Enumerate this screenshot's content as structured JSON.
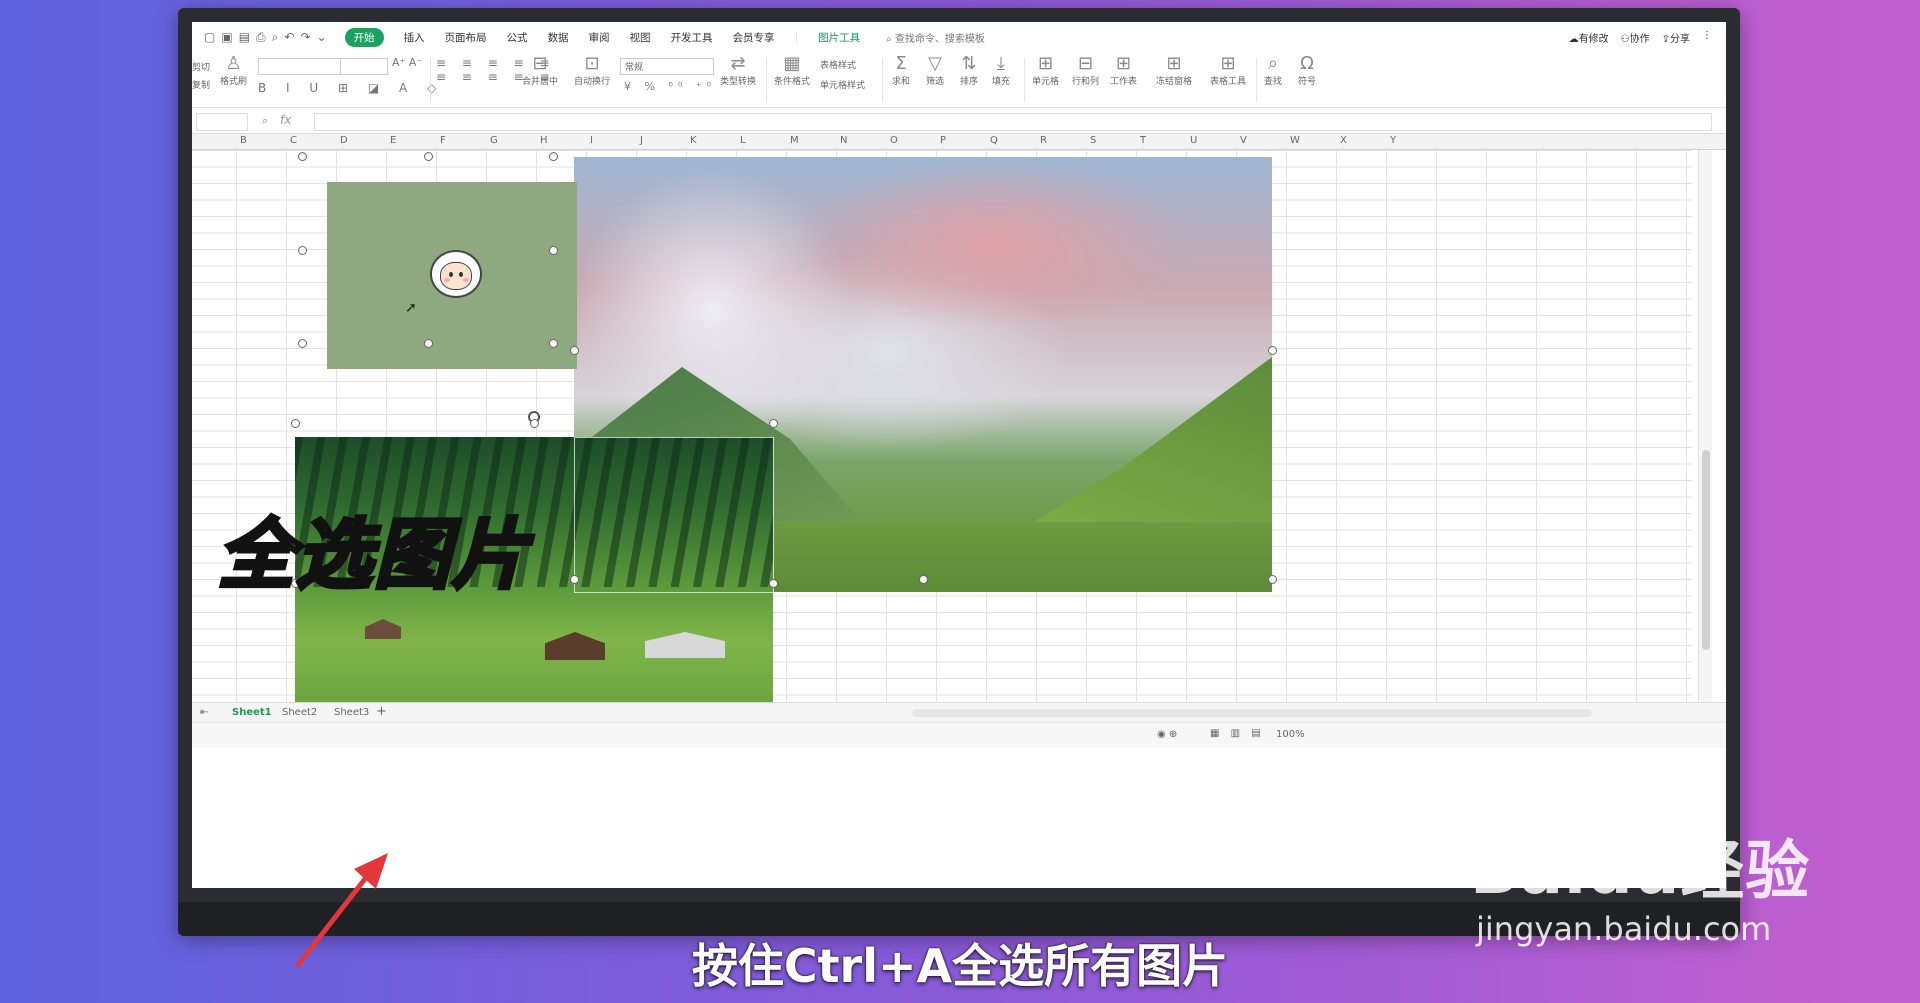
{
  "menu": {
    "tabs": [
      "开始",
      "插入",
      "页面布局",
      "公式",
      "数据",
      "审阅",
      "视图",
      "开发工具",
      "会员专享"
    ],
    "active_tab": "开始",
    "picture_tool": "图片工具",
    "search": "查找命令、搜索模板",
    "right": [
      "有修改",
      "协作",
      "分享"
    ]
  },
  "ribbon": {
    "cut": "剪切",
    "copy": "复制",
    "format_painter": "格式刷",
    "merge": "合并居中",
    "wrap": "自动换行",
    "number_format": "常规",
    "type_convert": "类型转换",
    "cond_format": "条件格式",
    "table_style": "表格样式",
    "cell_style": "单元格样式",
    "sum": "求和",
    "filter": "筛选",
    "sort": "排序",
    "fill": "填充",
    "cell": "单元格",
    "rowcol": "行和列",
    "worksheet": "工作表",
    "freeze": "冻结窗格",
    "table_tools": "表格工具",
    "find": "查找",
    "symbol": "符号"
  },
  "formula": {
    "fx": "fx"
  },
  "columns": [
    "B",
    "C",
    "D",
    "E",
    "F",
    "G",
    "H",
    "I",
    "J",
    "K",
    "L",
    "M",
    "N",
    "O",
    "P",
    "Q",
    "R",
    "S",
    "T",
    "U",
    "V",
    "W",
    "X",
    "Y"
  ],
  "sheets": [
    "Sheet1",
    "Sheet2",
    "Sheet3"
  ],
  "status": {
    "zoom": "100%"
  },
  "overlay": {
    "title": "全选图片",
    "subtitle": "按住Ctrl+A全选所有图片"
  },
  "watermark": {
    "logo": "Baidu经验",
    "url": "jingyan.baidu.com"
  },
  "colors": {
    "accent": "#1aa260",
    "arrow": "#e5373a"
  }
}
